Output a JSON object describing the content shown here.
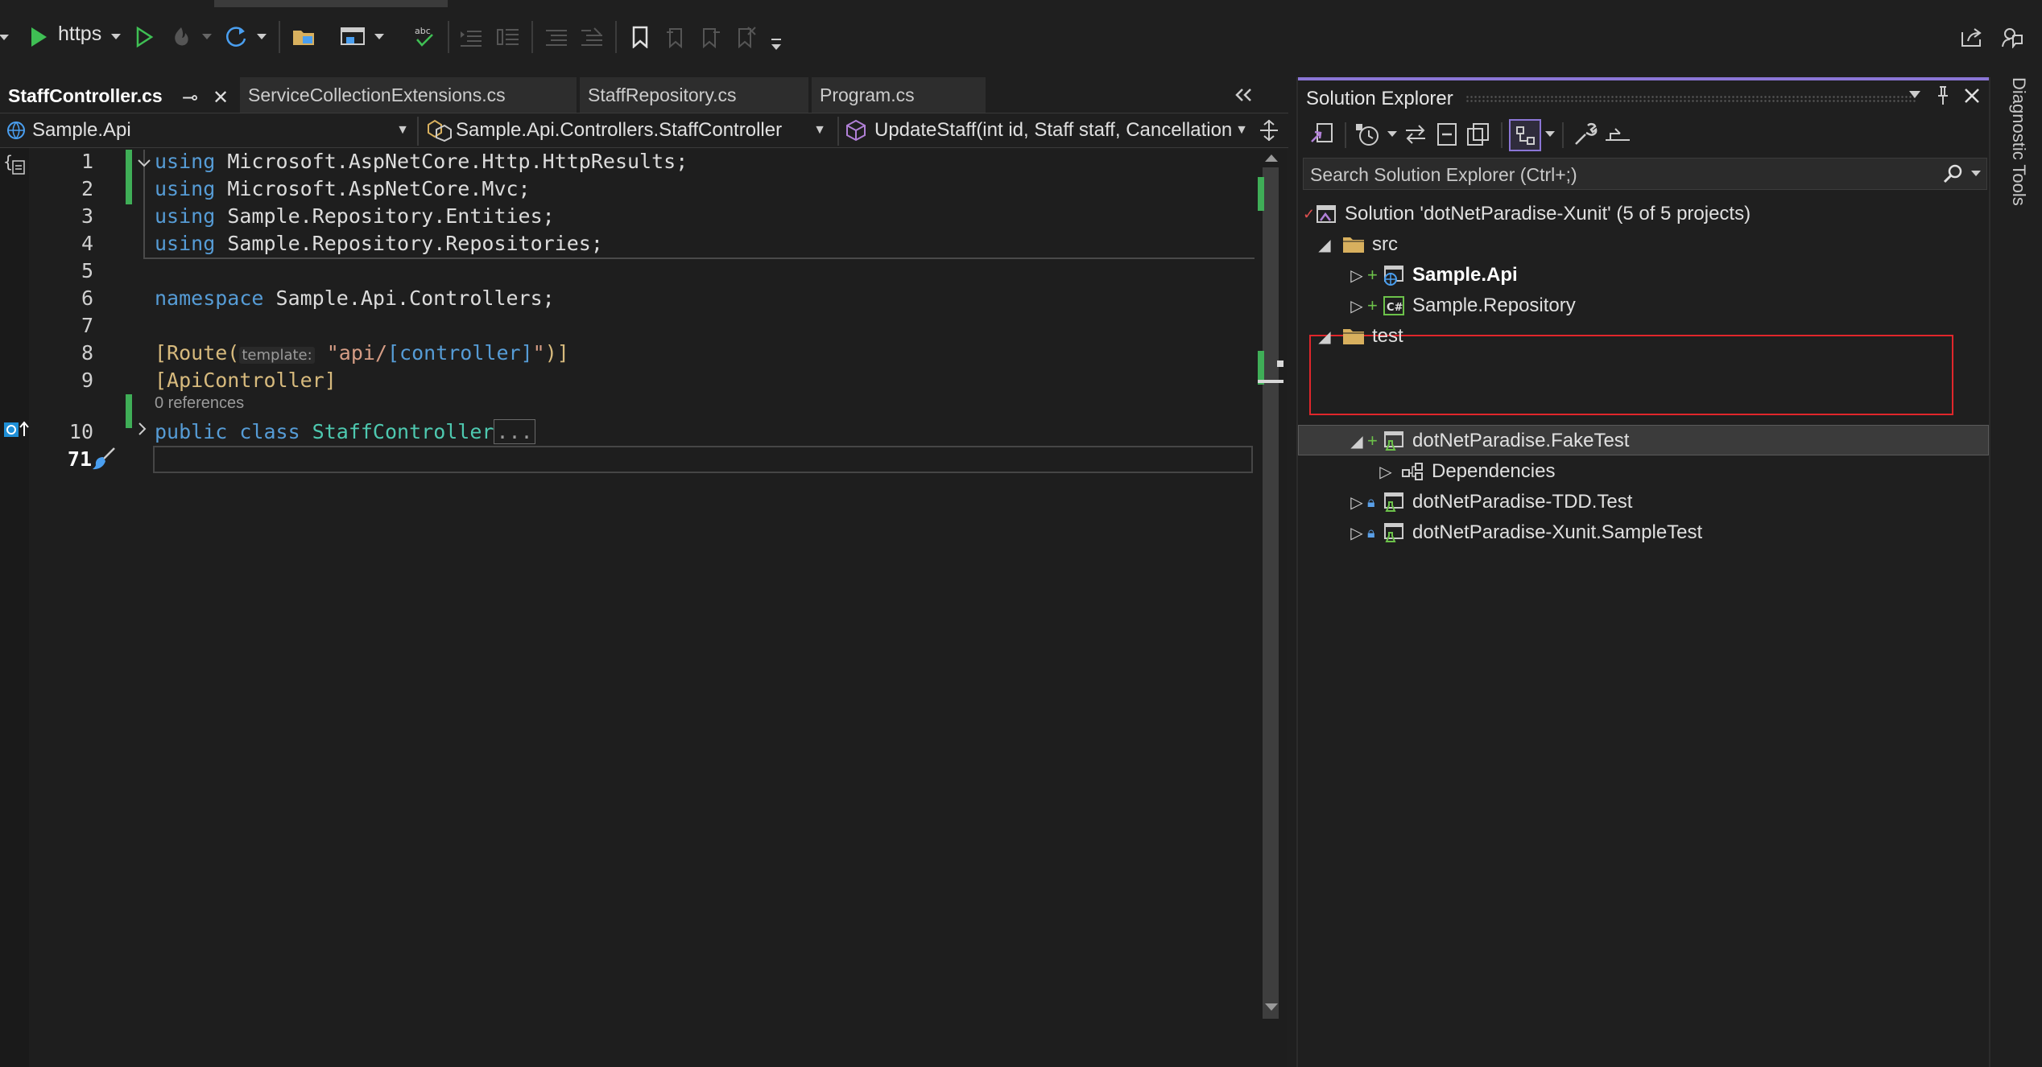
{
  "toolbar": {
    "run_target": "https",
    "buttons": [
      "start-icon",
      "dropdown-icon",
      "start-without-debugging-icon",
      "hot-reload-icon",
      "restart-icon",
      "open-folder-icon",
      "browser-link-icon",
      "spell-check-icon",
      "comment-icon",
      "uncomment-icon",
      "bookmark-icon",
      "share-icon",
      "feedback-icon"
    ]
  },
  "tabs": [
    {
      "label": "StaffController.cs",
      "active": true
    },
    {
      "label": "ServiceCollectionExtensions.cs",
      "active": false
    },
    {
      "label": "StaffRepository.cs",
      "active": false
    },
    {
      "label": "Program.cs",
      "active": false
    }
  ],
  "navbar": {
    "project": "Sample.Api",
    "type": "Sample.Api.Controllers.StaffController",
    "member": "UpdateStaff(int id, Staff staff, Cancellation"
  },
  "editor": {
    "line_numbers": [
      "1",
      "2",
      "3",
      "4",
      "5",
      "6",
      "7",
      "8",
      "9",
      "10",
      "71"
    ],
    "references_hint": "0 references",
    "lines": {
      "l1_kw": "using",
      "l1_rest": " Microsoft.AspNetCore.Http.HttpResults;",
      "l2_kw": "using",
      "l2_rest": " Microsoft.AspNetCore.Mvc;",
      "l3_kw": "using",
      "l3_rest": " Sample.Repository.Entities;",
      "l4_kw": "using",
      "l4_rest": " Sample.Repository.Repositories;",
      "l6_kw": "namespace",
      "l6_rest": " Sample.Api.Controllers;",
      "l8_open": "[Route(",
      "l8_hint": "template:",
      "l8_str_a": " \"api/",
      "l8_ctrl": "[controller]",
      "l8_str_b": "\"",
      "l8_close": ")]",
      "l9": "[ApiController]",
      "l10_kw": "public class",
      "l10_type": " StaffController",
      "l10_collapsed": "..."
    }
  },
  "solution_explorer": {
    "title": "Solution Explorer",
    "search_placeholder": "Search Solution Explorer (Ctrl+;)",
    "solution": "Solution 'dotNetParadise-Xunit' (5 of 5 projects)",
    "folders": {
      "src": "src",
      "test": "test"
    },
    "projects": {
      "sample_api": "Sample.Api",
      "sample_repository": "Sample.Repository",
      "fake_test": "dotNetParadise.FakeTest",
      "dependencies": "Dependencies",
      "tdd_test": "dotNetParadise-TDD.Test",
      "sample_test": "dotNetParadise-Xunit.SampleTest"
    }
  },
  "side_panel": {
    "diagnostic_tools": "Diagnostic Tools"
  },
  "colors": {
    "accent": "#8b76d6",
    "highlight_box": "#e0262b",
    "change_bar": "#3fae57",
    "keyword": "#569cd6",
    "type": "#4ec9b0",
    "string": "#d69d85"
  }
}
